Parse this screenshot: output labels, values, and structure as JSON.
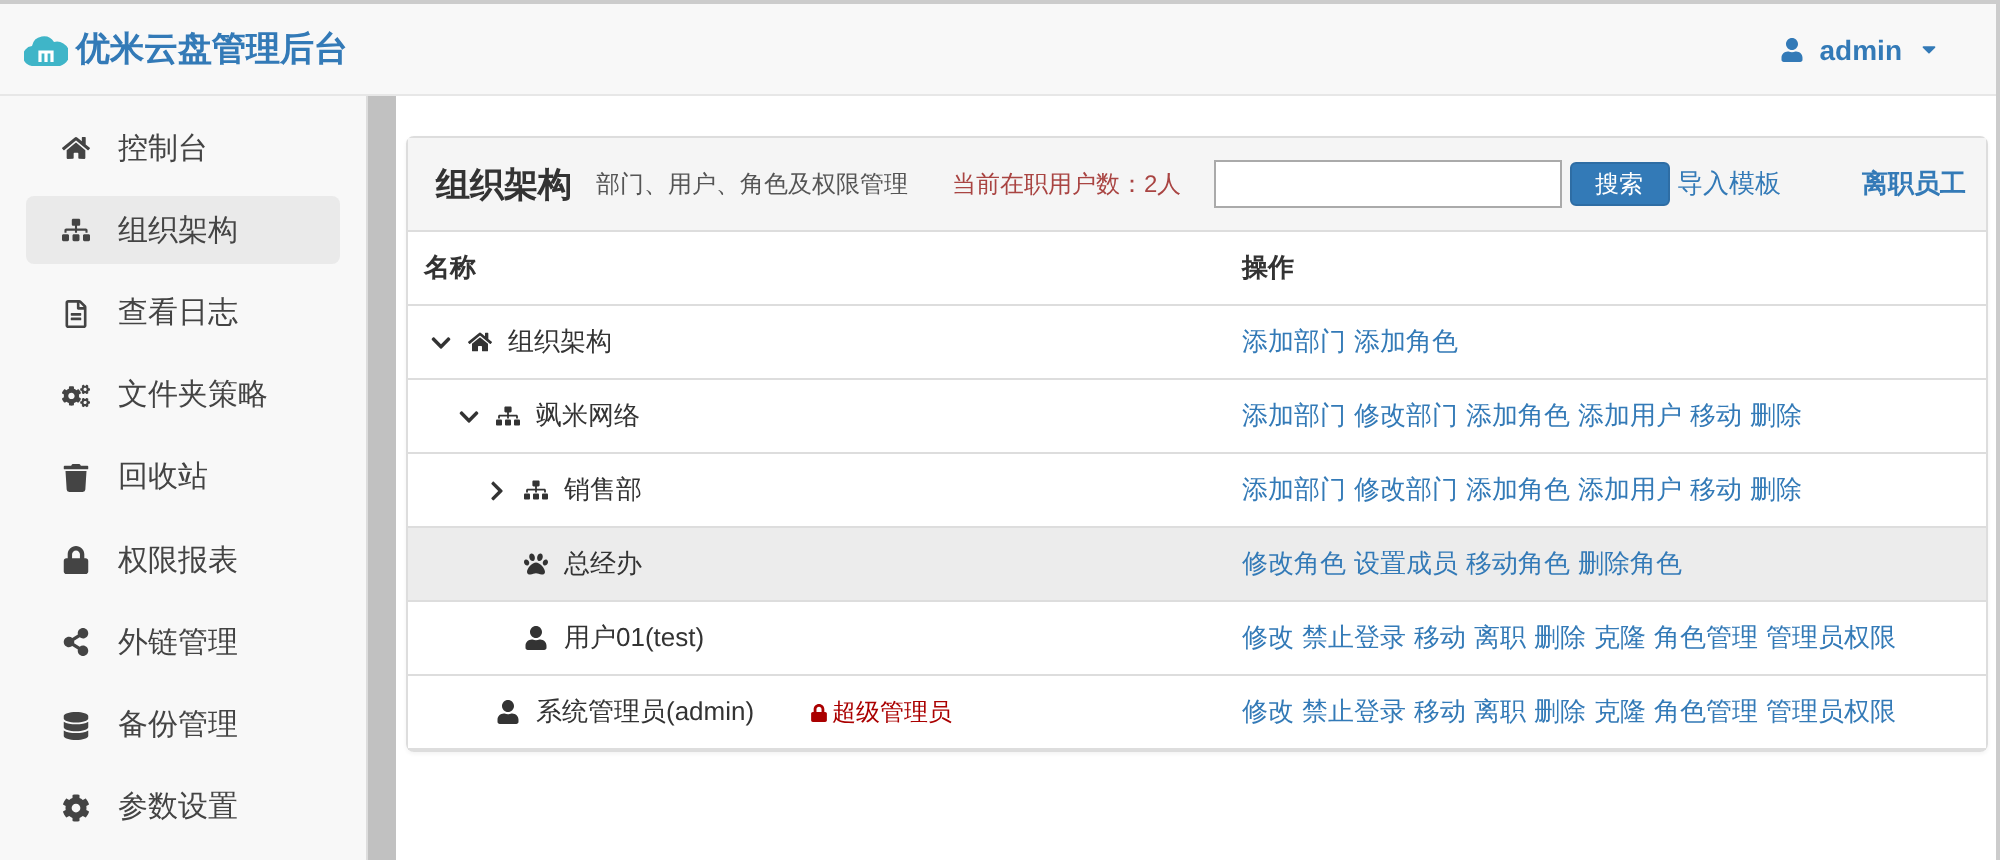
{
  "header": {
    "title": "优米云盘管理后台",
    "user": "admin"
  },
  "sidebar": {
    "items": [
      {
        "label": "控制台",
        "selected": false
      },
      {
        "label": "组织架构",
        "selected": true
      },
      {
        "label": "查看日志",
        "selected": false
      },
      {
        "label": "文件夹策略",
        "selected": false
      },
      {
        "label": "回收站",
        "selected": false
      },
      {
        "label": "权限报表",
        "selected": false
      },
      {
        "label": "外链管理",
        "selected": false
      },
      {
        "label": "备份管理",
        "selected": false
      },
      {
        "label": "参数设置",
        "selected": false
      }
    ]
  },
  "panel": {
    "title": "组织架构",
    "subtitle": "部门、用户、角色及权限管理",
    "user_count": "当前在职用户数：2人",
    "search_button": "搜索",
    "import_link": "导入模板",
    "resigned_link": "离职员工"
  },
  "table": {
    "columns": [
      "名称",
      "操作"
    ],
    "tree": [
      {
        "kind": "root",
        "label": "组织架构",
        "expanded": true,
        "highlighted": false,
        "actions": [
          "添加部门",
          "添加角色"
        ],
        "children": [
          {
            "kind": "dept",
            "label": "飒米网络",
            "expanded": true,
            "highlighted": false,
            "actions": [
              "添加部门",
              "修改部门",
              "添加角色",
              "添加用户",
              "移动",
              "删除"
            ],
            "children": [
              {
                "kind": "dept",
                "label": "销售部",
                "expanded": false,
                "highlighted": false,
                "actions": [
                  "添加部门",
                  "修改部门",
                  "添加角色",
                  "添加用户",
                  "移动",
                  "删除"
                ]
              },
              {
                "kind": "role",
                "label": "总经办",
                "highlighted": true,
                "actions": [
                  "修改角色",
                  "设置成员",
                  "移动角色",
                  "删除角色"
                ]
              },
              {
                "kind": "user",
                "label": "用户01(test)",
                "highlighted": false,
                "actions": [
                  "修改",
                  "禁止登录",
                  "移动",
                  "离职",
                  "删除",
                  "克隆",
                  "角色管理",
                  "管理员权限"
                ]
              }
            ]
          },
          {
            "kind": "user",
            "label": "系统管理员(admin)",
            "highlighted": false,
            "badge": "超级管理员",
            "actions": [
              "修改",
              "禁止登录",
              "移动",
              "离职",
              "删除",
              "克隆",
              "角色管理",
              "管理员权限"
            ]
          }
        ]
      }
    ]
  }
}
